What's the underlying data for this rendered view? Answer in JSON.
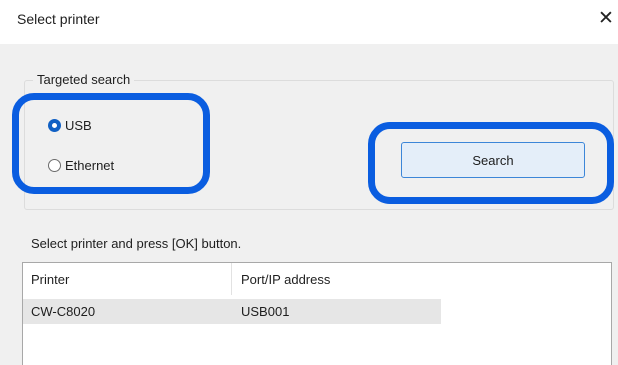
{
  "dialog": {
    "title": "Select printer",
    "close_glyph": "✕"
  },
  "targeted_search": {
    "legend": "Targeted search",
    "options": [
      {
        "label": "USB",
        "selected": true
      },
      {
        "label": "Ethernet",
        "selected": false
      }
    ],
    "search_label": "Search"
  },
  "instruction": "Select printer and press [OK] button.",
  "printer_list": {
    "columns": [
      "Printer",
      "Port/IP address"
    ],
    "rows": [
      {
        "printer": "CW-C8020",
        "port": "USB001"
      }
    ]
  },
  "colors": {
    "highlight": "#0a5de0",
    "radio_selected": "#1060c4",
    "button_border": "#3c86d8",
    "button_fill": "#e4eef9"
  }
}
